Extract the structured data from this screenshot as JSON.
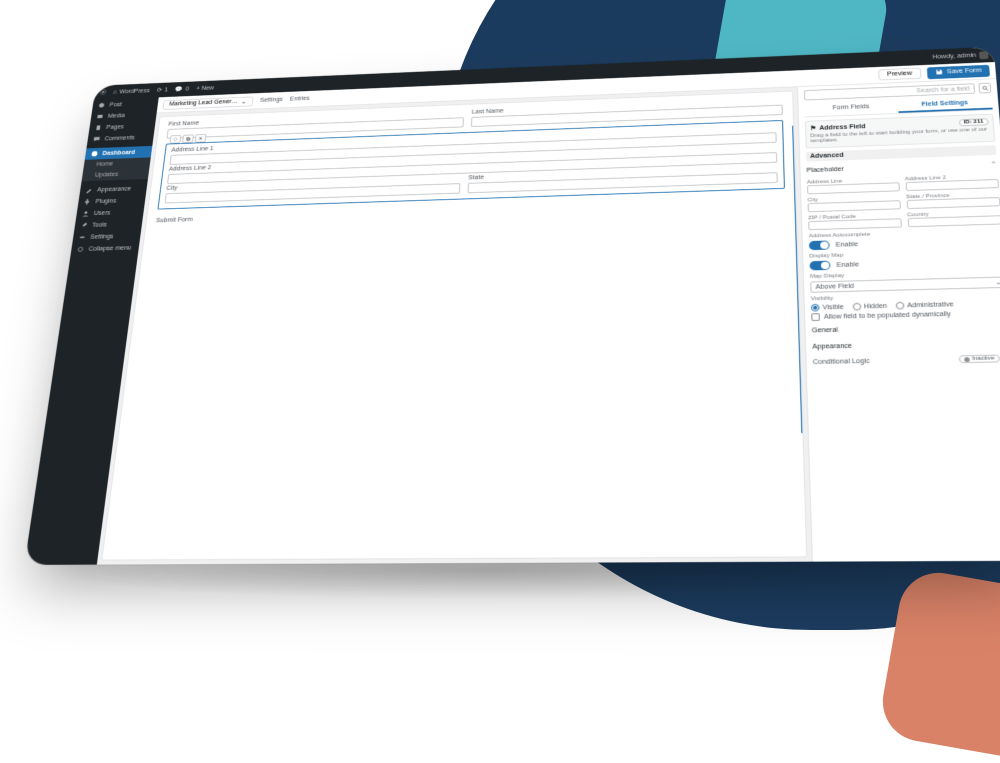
{
  "toolbar": {
    "site_name": "WordPress",
    "comments_count": "0",
    "updates_count": "1",
    "new_label": "+ New",
    "howdy": "Howdy, admin"
  },
  "sidebar": {
    "items": [
      {
        "label": "Post"
      },
      {
        "label": "Media"
      },
      {
        "label": "Pages"
      },
      {
        "label": "Comments"
      },
      {
        "label": "Dashboard",
        "current": true
      },
      {
        "label": "Home",
        "sub": true
      },
      {
        "label": "Updates",
        "sub": true
      },
      {
        "label": "Appearance"
      },
      {
        "label": "Plugins"
      },
      {
        "label": "Users"
      },
      {
        "label": "Tools"
      },
      {
        "label": "Settings"
      },
      {
        "label": "Collapse menu"
      }
    ]
  },
  "builder": {
    "form_title": "Marketing Lead Gener…",
    "tabs": {
      "settings": "Settings",
      "entries": "Entries"
    },
    "preview": "Preview",
    "save": "Save Form",
    "fields": {
      "first_name": "First Name",
      "last_name": "Last Name",
      "address1": "Address Line 1",
      "address2": "Address Line 2",
      "city": "City",
      "state": "State",
      "submit": "Submit Form"
    },
    "selected_tools": [
      "move",
      "duplicate",
      "delete"
    ]
  },
  "right": {
    "search_placeholder": "Search for a field",
    "tabs": {
      "form_fields": "Form Fields",
      "field_settings": "Field Settings"
    },
    "info": {
      "title": "Address Field",
      "id": "ID: 211",
      "desc": "Drag a field to the left to start building your form, or use one of our templates."
    },
    "sections": {
      "advanced": "Advanced"
    },
    "placeholder": {
      "title": "Placeholder",
      "cells": [
        "Address Line",
        "Address Line 2",
        "City",
        "State / Province",
        "ZIP / Postal Code",
        "Country"
      ]
    },
    "autocomplete": {
      "title": "Address Autocomplete",
      "label": "Enable"
    },
    "display_map": {
      "title": "Display Map",
      "label": "Enable"
    },
    "map_display": {
      "title": "Map Display",
      "value": "Above Field"
    },
    "visibility": {
      "title": "Visibility",
      "options": [
        "Visible",
        "Hidden",
        "Administrative"
      ],
      "dynamic": "Allow field to be populated dynamically"
    },
    "groups": {
      "general": "General",
      "appearance": "Appearance",
      "conditional": "Conditional Logic"
    },
    "conditional_state": "Inactive"
  }
}
